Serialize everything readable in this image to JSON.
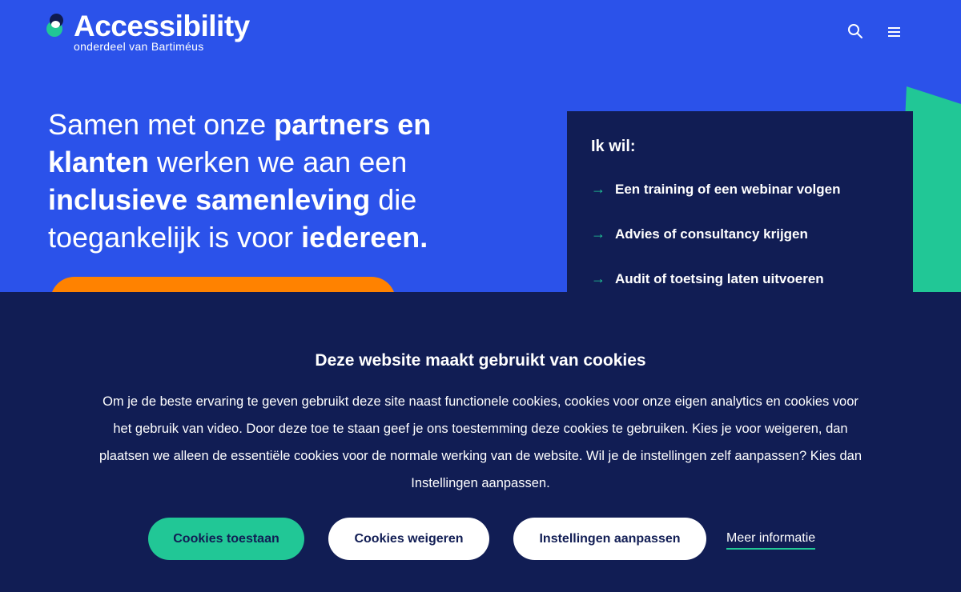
{
  "header": {
    "logo_title": "Accessibility",
    "logo_subtitle": "onderdeel van Bartiméus",
    "search_icon": "search-icon",
    "menu_icon": "hamburger-menu-icon"
  },
  "hero": {
    "parts": [
      {
        "text": "Samen met onze ",
        "bold": false
      },
      {
        "text": "partners en klanten",
        "bold": true
      },
      {
        "text": " werken we aan een ",
        "bold": false
      },
      {
        "text": "inclusieve samenleving",
        "bold": true
      },
      {
        "text": " die toegankelijk is voor ",
        "bold": false
      },
      {
        "text": "iedereen.",
        "bold": true
      }
    ]
  },
  "panel": {
    "title": "Ik wil:",
    "items": [
      "Een training of een webinar volgen",
      "Advies of consultancy krijgen",
      "Audit of toetsing laten uitvoeren"
    ]
  },
  "cookie": {
    "title": "Deze website maakt gebruikt van cookies",
    "text": "Om je de beste ervaring te geven gebruikt deze site naast functionele cookies, cookies voor onze eigen analytics en cookies voor het gebruik van video. Door deze toe te staan geef je ons toestemming deze cookies te gebruiken. Kies je voor weigeren, dan plaatsen we alleen de essentiële cookies voor de normale werking van de website. Wil je de instellingen zelf aanpassen? Kies dan Instellingen aanpassen.",
    "accept_label": "Cookies toestaan",
    "refuse_label": "Cookies weigeren",
    "settings_label": "Instellingen aanpassen",
    "more_label": "Meer informatie"
  },
  "colors": {
    "background": "#2b52ea",
    "navy": "#111d54",
    "teal": "#21c796",
    "orange": "#ff8200"
  }
}
